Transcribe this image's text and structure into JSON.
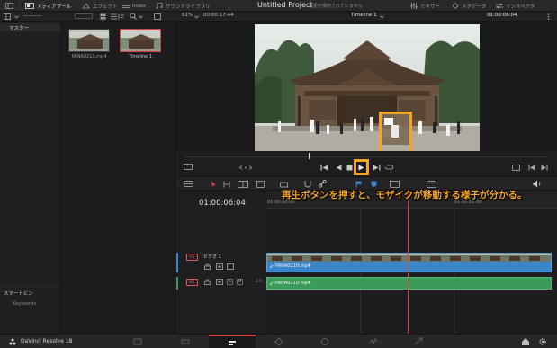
{
  "topbar": {
    "media_pool": "メディアプール",
    "effects": "エフェクト",
    "index": "Index",
    "sound_library": "サウンドライブラリ",
    "project_title": "Untitled Project",
    "unsaved_status": "変更が保存されていません",
    "mixer": "ミキサー",
    "metadata": "メタデータ",
    "inspector": "インスペクタ"
  },
  "subbar": {
    "zoom": "61%",
    "source_timecode": "00:00:17:44",
    "timeline_name": "Timeline 1",
    "record_timecode": "01:00:06:04"
  },
  "left_panel": {
    "master_label": "マスター",
    "smart_bins_label": "スマートビン",
    "keywords_label": "Keywords"
  },
  "media_pool": {
    "clips": [
      {
        "name": "PANA0210.mp4"
      },
      {
        "name": "Timeline 1"
      }
    ]
  },
  "timeline": {
    "timecode": "01:00:06:04",
    "ruler_labels": [
      "01:00:00:00",
      "01:00:10:00"
    ],
    "video_track": {
      "tag": "V1",
      "name": "ビデオ 1",
      "clip_name": "PANA0210.mp4"
    },
    "audio_track": {
      "tag": "A1",
      "solo": "S",
      "mute": "M",
      "level": "2.0",
      "clip_name": "PANA0210.mp4"
    }
  },
  "annotation": "再生ボタンを押すと、モザイクが移動する様子が分かる。",
  "bottombar": {
    "app_name": "DaVinci Resolve 18"
  },
  "colors": {
    "highlight_box": "#f5a623",
    "playhead": "#e0443b",
    "video_track": "#3a86c8",
    "audio_track": "#3c9a5a",
    "selected_border": "#d94242"
  }
}
